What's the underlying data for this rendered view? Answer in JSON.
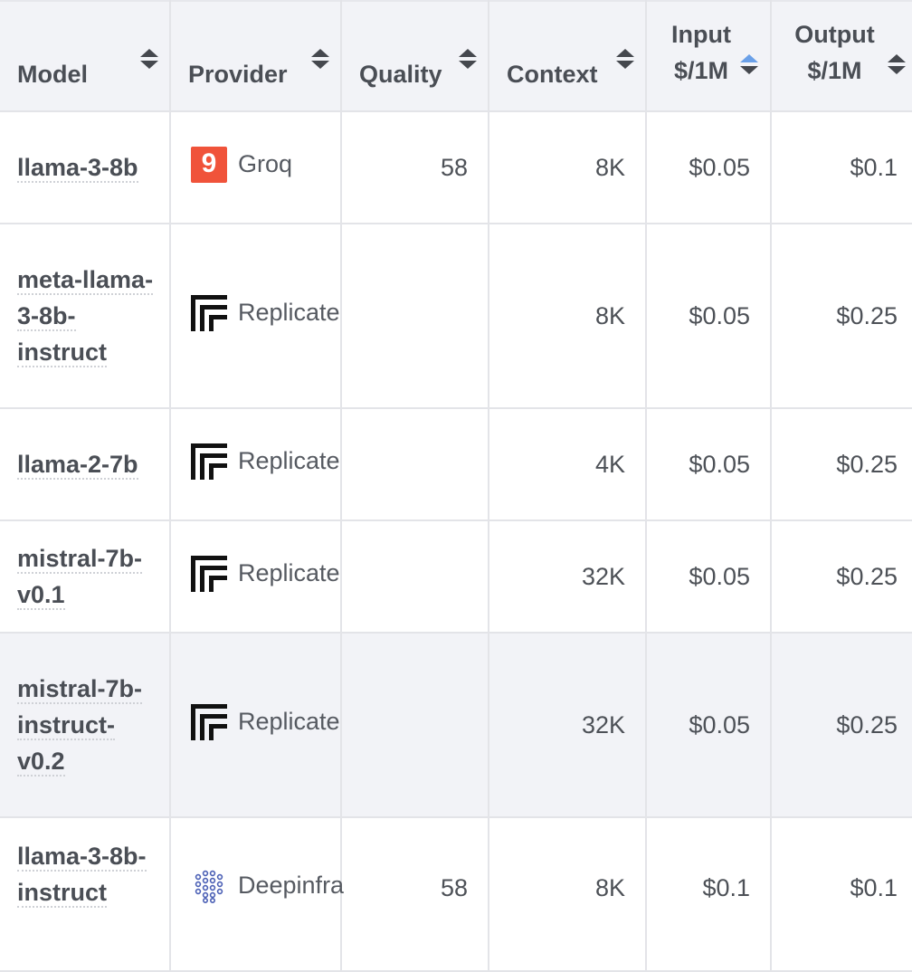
{
  "table": {
    "headers": {
      "model": "Model",
      "provider": "Provider",
      "quality": "Quality",
      "context": "Context",
      "input_line1": "Input",
      "input_line2": "$/1M",
      "output_line1": "Output",
      "output_line2": "$/1M"
    },
    "sort": {
      "column": "input",
      "direction": "ascending",
      "active_color": "#6aa0e8"
    },
    "rows": [
      {
        "model": "llama-3-8b",
        "provider": "Groq",
        "provider_icon": "groq-logo-icon",
        "quality": "58",
        "context": "8K",
        "input": "$0.05",
        "output": "$0.1"
      },
      {
        "model": "meta-llama-3-8b-instruct",
        "provider": "Replicate",
        "provider_icon": "replicate-logo-icon",
        "quality": "",
        "context": "8K",
        "input": "$0.05",
        "output": "$0.25"
      },
      {
        "model": "llama-2-7b",
        "provider": "Replicate",
        "provider_icon": "replicate-logo-icon",
        "quality": "",
        "context": "4K",
        "input": "$0.05",
        "output": "$0.25"
      },
      {
        "model": "mistral-7b-v0.1",
        "provider": "Replicate",
        "provider_icon": "replicate-logo-icon",
        "quality": "",
        "context": "32K",
        "input": "$0.05",
        "output": "$0.25"
      },
      {
        "model": "mistral-7b-instruct-v0.2",
        "provider": "Replicate",
        "provider_icon": "replicate-logo-icon",
        "quality": "",
        "context": "32K",
        "input": "$0.05",
        "output": "$0.25"
      },
      {
        "model": "llama-3-8b-instruct",
        "provider": "Deepinfra",
        "provider_icon": "deepinfra-logo-icon",
        "quality": "58",
        "context": "8K",
        "input": "$0.1",
        "output": "$0.1"
      }
    ]
  },
  "colors": {
    "groq_brand": "#f0533a",
    "header_bg": "#f2f3f7",
    "border": "#e3e4e8"
  }
}
